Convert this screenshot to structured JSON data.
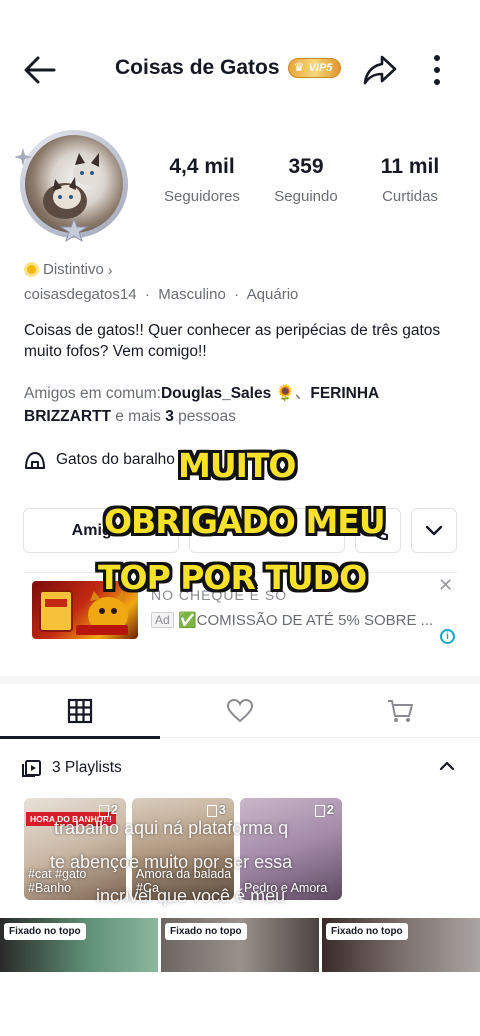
{
  "header": {
    "title": "Coisas de Gatos",
    "vip_badge": "VIP5"
  },
  "stats": [
    {
      "value": "4,4 mil",
      "label": "Seguidores"
    },
    {
      "value": "359",
      "label": "Seguindo"
    },
    {
      "value": "11 mil",
      "label": "Curtidas"
    }
  ],
  "profile": {
    "badge_label": "Distintivo",
    "username": "coisasdegatos14",
    "gender": "Masculino",
    "sign": "Aquário",
    "bio": "Coisas de gatos!! Quer conhecer as peripécias de três gatos muito fofos? Vem comigo!!",
    "friends_prefix": "Amigos em comum:",
    "friend1": "Douglas_Sales 🌻",
    "separator": "、",
    "friend2": "FERINHA BRIZZARTT",
    "friends_more_prefix": " e mais ",
    "friends_more_count": "3",
    "friends_more_suffix": " pessoas",
    "showcase_label": "Gatos do baralho"
  },
  "actions": {
    "friends_button": "Amigos",
    "dropdown_icon": "chevron-down-icon"
  },
  "ad": {
    "headline": "NO CHEQUE E SÓ",
    "tag": "Ad",
    "text": "✅COMISSÃO DE ATÉ 5% SOBRE ..."
  },
  "tabs": [
    {
      "icon": "grid-icon",
      "active": true
    },
    {
      "icon": "heart-icon",
      "active": false
    },
    {
      "icon": "cart-icon",
      "active": false
    }
  ],
  "playlists": {
    "heading": "3 Playlists",
    "items": [
      {
        "count": "2",
        "banner": "HORA DO BANHO!!!",
        "title": "#cat #gato #Banho"
      },
      {
        "count": "3",
        "title": "Amora da balada   #Ca"
      },
      {
        "count": "2",
        "title": "Pedro e Amora"
      }
    ]
  },
  "pinned": [
    {
      "label": "Fixado no topo"
    },
    {
      "label": "Fixado no topo"
    },
    {
      "label": "Fixado no topo"
    }
  ],
  "overlay_caption": {
    "line1": "MUITO",
    "line2": "OBRIGADO MEU",
    "line3": "TOP POR TUDO"
  },
  "subtitle_overlay": {
    "line1": "trabalho aqui ná plataforma q",
    "line2": "te abençoe muito por ser essa",
    "line3": "incrivel que você é meu"
  },
  "colors": {
    "text": "#161823",
    "muted": "#6b6d74",
    "caption_yellow": "#f7e12b",
    "vip_gold": "#e8a63a"
  }
}
